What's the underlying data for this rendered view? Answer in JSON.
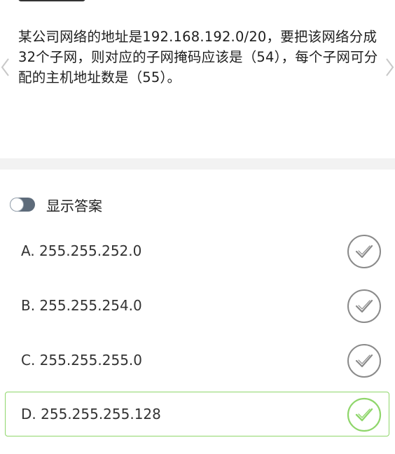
{
  "question": {
    "text": "某公司网络的地址是192.168.192.0/20，要把该网络分成32个子网，则对应的子网掩码应该是（54），每个子网可分配的主机地址数是（55）。"
  },
  "toggle": {
    "label": "显示答案",
    "on": false
  },
  "options": [
    {
      "label": "A. 255.255.252.0",
      "selected": false
    },
    {
      "label": "B. 255.255.254.0",
      "selected": false
    },
    {
      "label": "C. 255.255.255.0",
      "selected": false
    },
    {
      "label": "D. 255.255.255.128",
      "selected": true
    }
  ],
  "colors": {
    "selected_accent": "#8fd66b",
    "unselected_icon": "#8a8a8a",
    "toggle_off": "#5d6b7a",
    "band": "#f2f2f2"
  },
  "icons": {
    "prev": "chevron-left-icon",
    "next": "chevron-right-icon",
    "check": "check-circle-icon"
  }
}
